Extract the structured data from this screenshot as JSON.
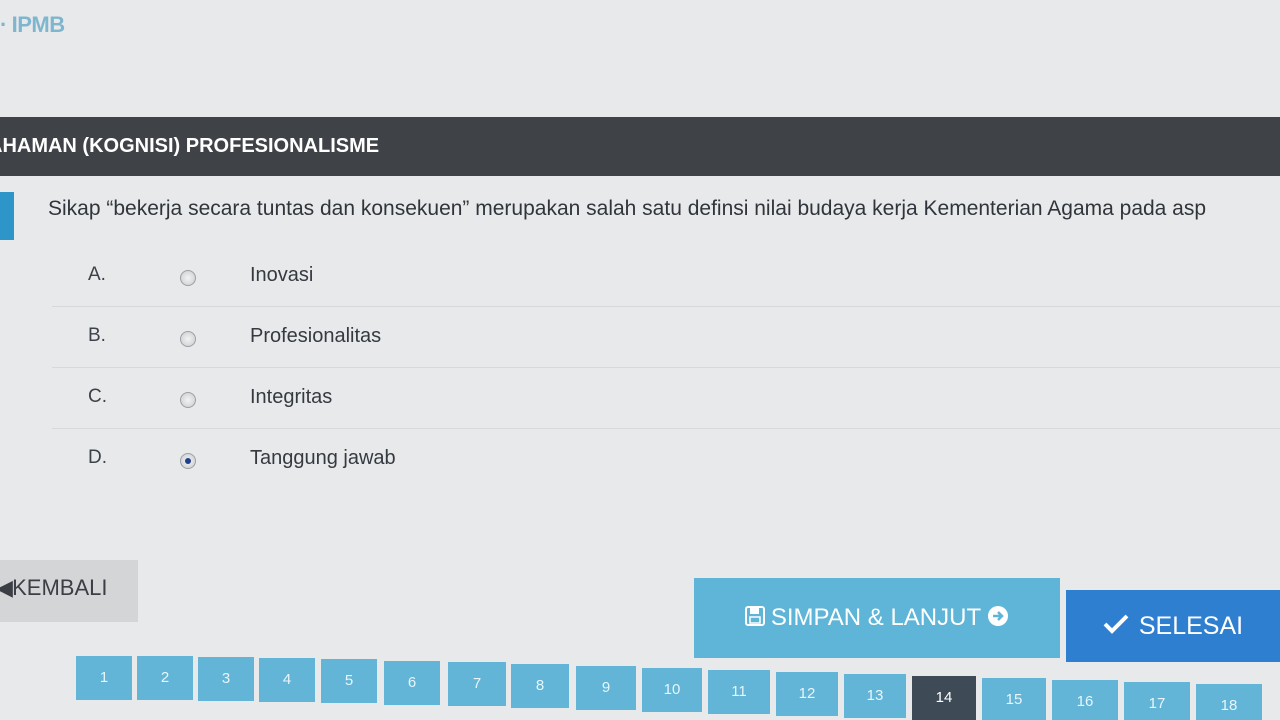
{
  "header": {
    "brand": "IPMB",
    "section_title": "AHAMAN (KOGNISI) PROFESIONALISME"
  },
  "question": {
    "text": "Sikap “bekerja secara tuntas dan konsekuen” merupakan salah satu definsi nilai budaya kerja Kementerian Agama pada asp"
  },
  "options": [
    {
      "letter": "A.",
      "label": "Inovasi",
      "selected": false
    },
    {
      "letter": "B.",
      "label": "Profesionalitas",
      "selected": false
    },
    {
      "letter": "C.",
      "label": "Integritas",
      "selected": false
    },
    {
      "letter": "D.",
      "label": "Tanggung jawab",
      "selected": true
    }
  ],
  "actions": {
    "back_label": "KEMBALI",
    "save_next_label": "SIMPAN & LANJUT",
    "finish_label": "SELESAI"
  },
  "pagination": {
    "pages": [
      "1",
      "2",
      "3",
      "4",
      "5",
      "6",
      "7",
      "8",
      "9",
      "10",
      "11",
      "12",
      "13",
      "14",
      "15",
      "16",
      "17",
      "18"
    ],
    "current": "14"
  },
  "colors": {
    "header_bg": "#3f4347",
    "accent": "#2e95c8",
    "save_button": "#5fb5d8",
    "finish_button": "#2f7fd1",
    "page_button": "#62b5d6",
    "current_page": "#3e4a55"
  },
  "icons": {
    "save": "floppy-disk-icon",
    "next": "arrow-circle-right-icon",
    "finish": "check-icon",
    "back": "arrow-left-icon"
  }
}
